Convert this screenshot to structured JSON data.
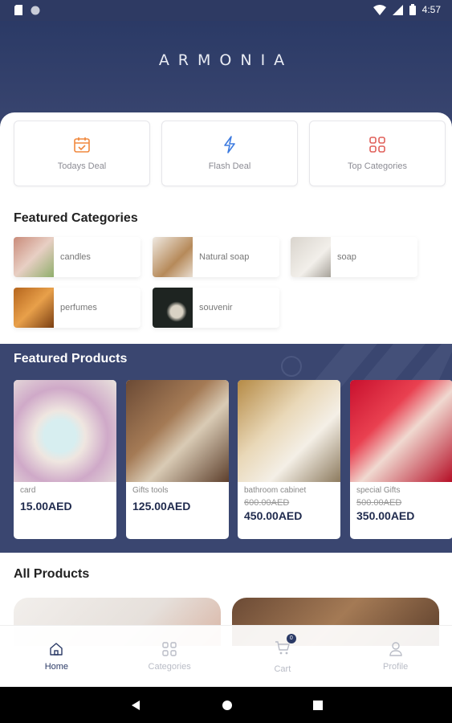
{
  "status_bar": {
    "time": "4:57"
  },
  "app": {
    "logo_text": "ARMONIA"
  },
  "deals": [
    {
      "label": "Todays Deal",
      "icon": "calendar-icon"
    },
    {
      "label": "Flash Deal",
      "icon": "lightning-icon"
    },
    {
      "label": "Top Categories",
      "icon": "grid-icon"
    }
  ],
  "featured_categories": {
    "title": "Featured Categories",
    "items": [
      {
        "name": "candles"
      },
      {
        "name": "Natural soap"
      },
      {
        "name": "soap"
      },
      {
        "name": "perfumes"
      },
      {
        "name": "souvenir"
      }
    ]
  },
  "featured_products": {
    "title": "Featured Products",
    "items": [
      {
        "name": "card",
        "old_price": "",
        "price": "15.00AED"
      },
      {
        "name": "Gifts tools",
        "old_price": "",
        "price": "125.00AED"
      },
      {
        "name": "bathroom cabinet",
        "old_price": "600.00AED",
        "price": "450.00AED"
      },
      {
        "name": "special Gifts",
        "old_price": "500.00AED",
        "price": "350.00AED"
      }
    ]
  },
  "all_products": {
    "title": "All Products"
  },
  "bottom_nav": {
    "items": [
      {
        "label": "Home",
        "icon": "home-icon",
        "active": true
      },
      {
        "label": "Categories",
        "icon": "categories-icon",
        "active": false
      },
      {
        "label": "Cart",
        "icon": "cart-icon",
        "active": false,
        "badge": "0"
      },
      {
        "label": "Profile",
        "icon": "profile-icon",
        "active": false
      }
    ]
  },
  "colors": {
    "primary": "#2b3a66",
    "band": "#3a4670",
    "accent_orange": "#f0883e",
    "accent_blue": "#3d7be0",
    "accent_red": "#e0605a"
  }
}
